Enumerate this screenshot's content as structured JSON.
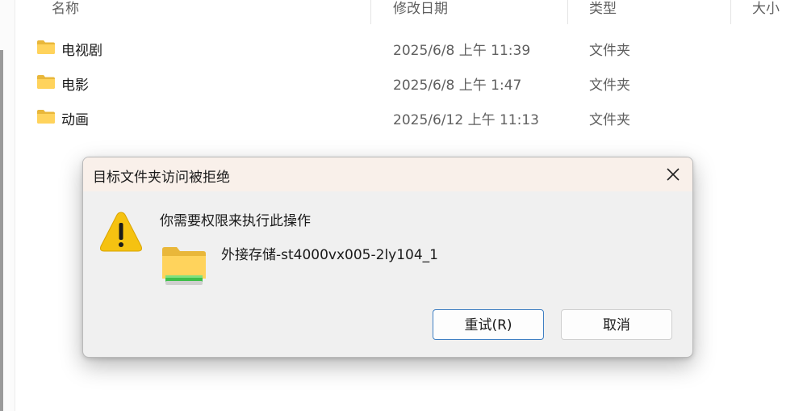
{
  "header": {
    "columns": [
      {
        "label": "名称"
      },
      {
        "label": "修改日期"
      },
      {
        "label": "类型"
      },
      {
        "label": "大小"
      }
    ]
  },
  "files": [
    {
      "name": "电视剧",
      "date": "2025/6/8 上午 11:39",
      "type": "文件夹",
      "icon": "folder-icon"
    },
    {
      "name": "电影",
      "date": "2025/6/8 上午 1:47",
      "type": "文件夹",
      "icon": "folder-icon"
    },
    {
      "name": "动画",
      "date": "2025/6/12 上午 11:13",
      "type": "文件夹",
      "icon": "folder-icon"
    }
  ],
  "dialog": {
    "title": "目标文件夹访问被拒绝",
    "message": "你需要权限来执行此操作",
    "item_name": "外接存储-st4000vx005-2ly104_1",
    "retry_label": "重试(R)",
    "cancel_label": "取消",
    "icons": {
      "warning": "warning-icon",
      "drive": "external-drive-folder-icon",
      "close": "close-icon"
    }
  },
  "colors": {
    "accent": "#3f7fc2",
    "dialog_bg": "#f0f0f0",
    "titlebar_bg": "#f9f0ea",
    "warning_yellow": "#f5c211"
  }
}
